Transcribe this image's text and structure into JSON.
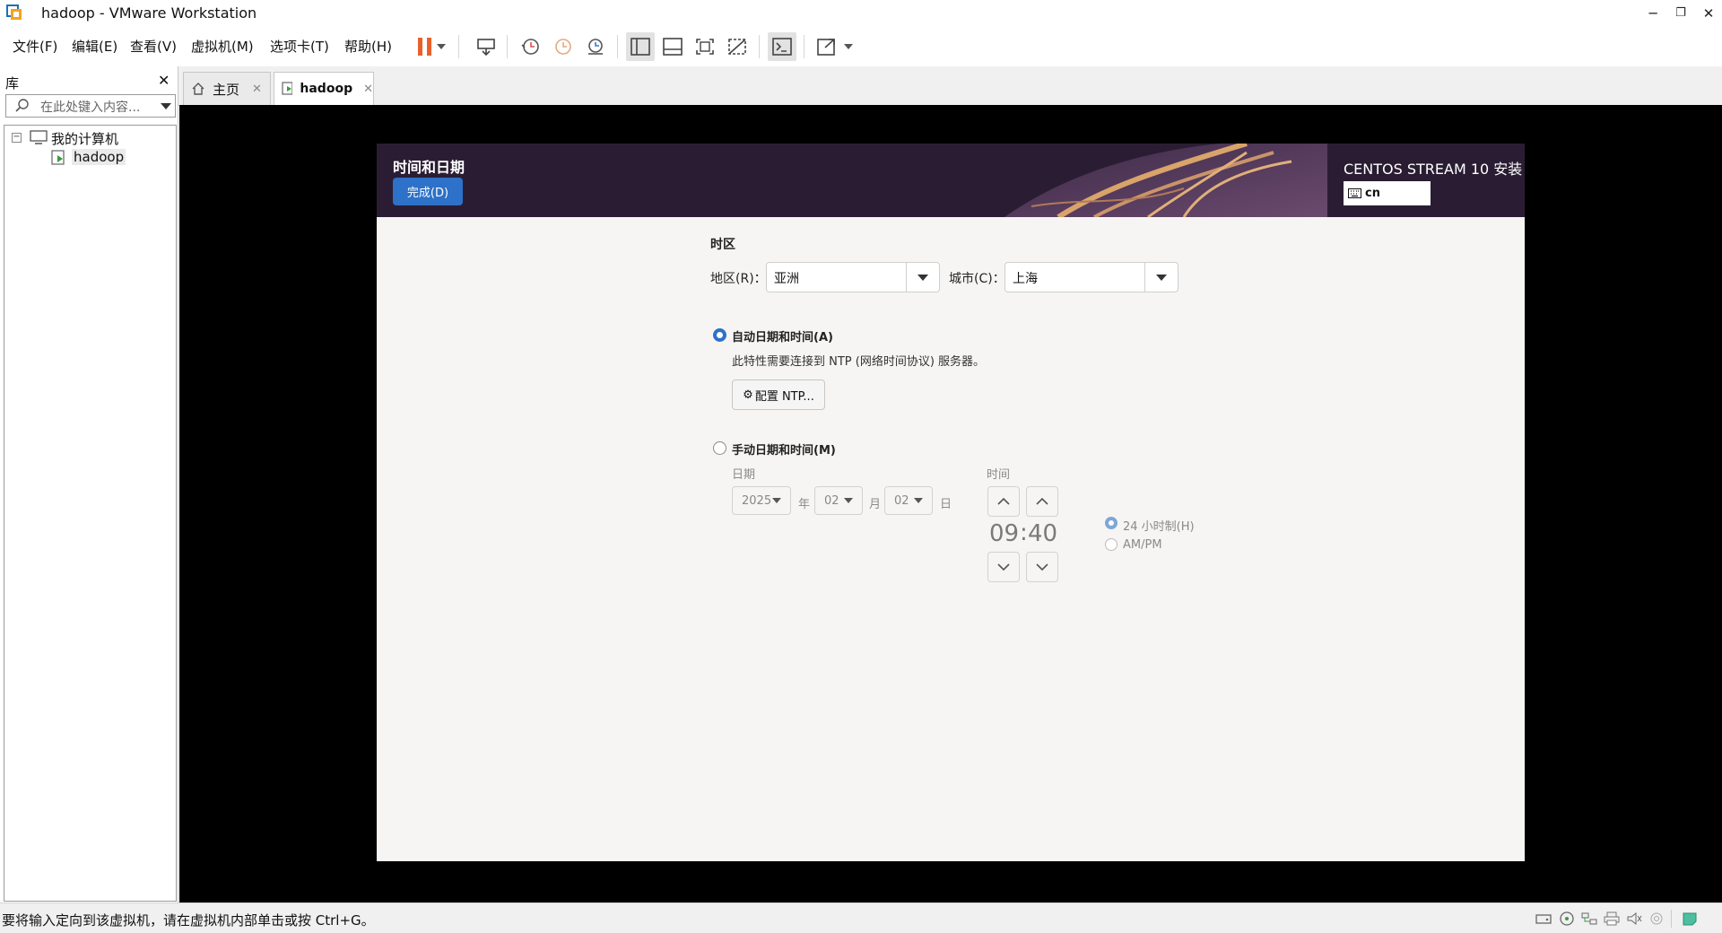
{
  "window": {
    "title": "hadoop - VMware Workstation"
  },
  "menu": [
    "文件(F)",
    "编辑(E)",
    "查看(V)",
    "虚拟机(M)",
    "选项卡(T)",
    "帮助(H)"
  ],
  "library": {
    "title": "库",
    "search_placeholder": "在此处键入内容...",
    "tree": {
      "root": "我的计算机",
      "vm": "hadoop"
    }
  },
  "tabs": [
    {
      "label": "主页",
      "icon": "home-icon"
    },
    {
      "label": "hadoop",
      "icon": "vm-icon"
    }
  ],
  "installer": {
    "page_title": "时间和日期",
    "done_label": "完成(D)",
    "product": "CENTOS STREAM 10 安装",
    "keyboard": "cn",
    "timezone": {
      "heading": "时区",
      "region_label": "地区(R)：",
      "region_value": "亚洲",
      "city_label": "城市(C)：",
      "city_value": "上海"
    },
    "auto": {
      "label": "自动日期和时间(A)",
      "selected": true,
      "note": "此特性需要连接到 NTP (网络时间协议) 服务器。",
      "ntp_button": "配置 NTP..."
    },
    "manual": {
      "label": "手动日期和时间(M)",
      "selected": false,
      "date_label": "日期",
      "year": "2025",
      "year_unit": "年",
      "month": "02",
      "month_unit": "月",
      "day": "02",
      "day_unit": "日",
      "time_label": "时间",
      "hour": "09",
      "minute": "40",
      "format_24": "24 小时制(H)",
      "format_ampm": "AM/PM",
      "format_selected": "24"
    }
  },
  "statusbar": {
    "message": "要将输入定向到该虚拟机，请在虚拟机内部单击或按 Ctrl+G。"
  },
  "colors": {
    "accent": "#2d71c8",
    "pause": "#e8612c",
    "banner": "#2a1d33"
  }
}
